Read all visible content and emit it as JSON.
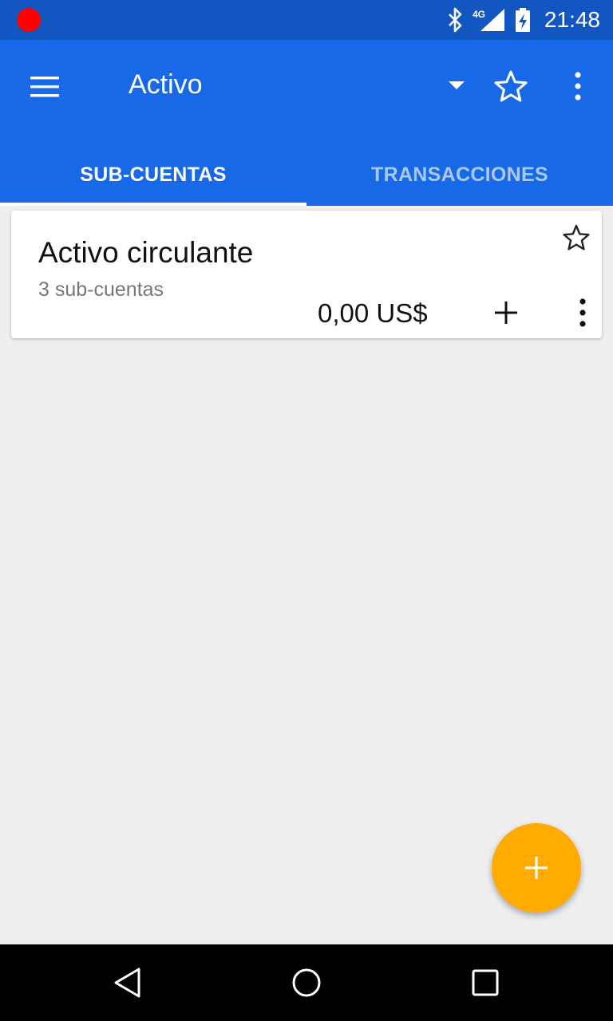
{
  "status_bar": {
    "time": "21:48",
    "network": "4G",
    "icons": [
      "record-dot",
      "bluetooth-icon",
      "signal-icon",
      "battery-charging-icon"
    ]
  },
  "app_bar": {
    "title": "Activo",
    "icons": [
      "menu-icon",
      "dropdown-icon",
      "star-outline-icon",
      "more-vert-icon"
    ],
    "color": "#1769e7"
  },
  "tabs": [
    {
      "label": "SUB-CUENTAS",
      "active": true
    },
    {
      "label": "TRANSACCIONES",
      "active": false
    }
  ],
  "accounts": [
    {
      "name": "Activo circulante",
      "subtitle": "3 sub-cuentas",
      "balance": "0,00 US$",
      "favorite": false
    }
  ],
  "fab": {
    "icon": "add-icon",
    "color": "#ffab00"
  },
  "nav_bar": {
    "icons": [
      "back-icon",
      "home-icon",
      "recents-icon"
    ]
  }
}
